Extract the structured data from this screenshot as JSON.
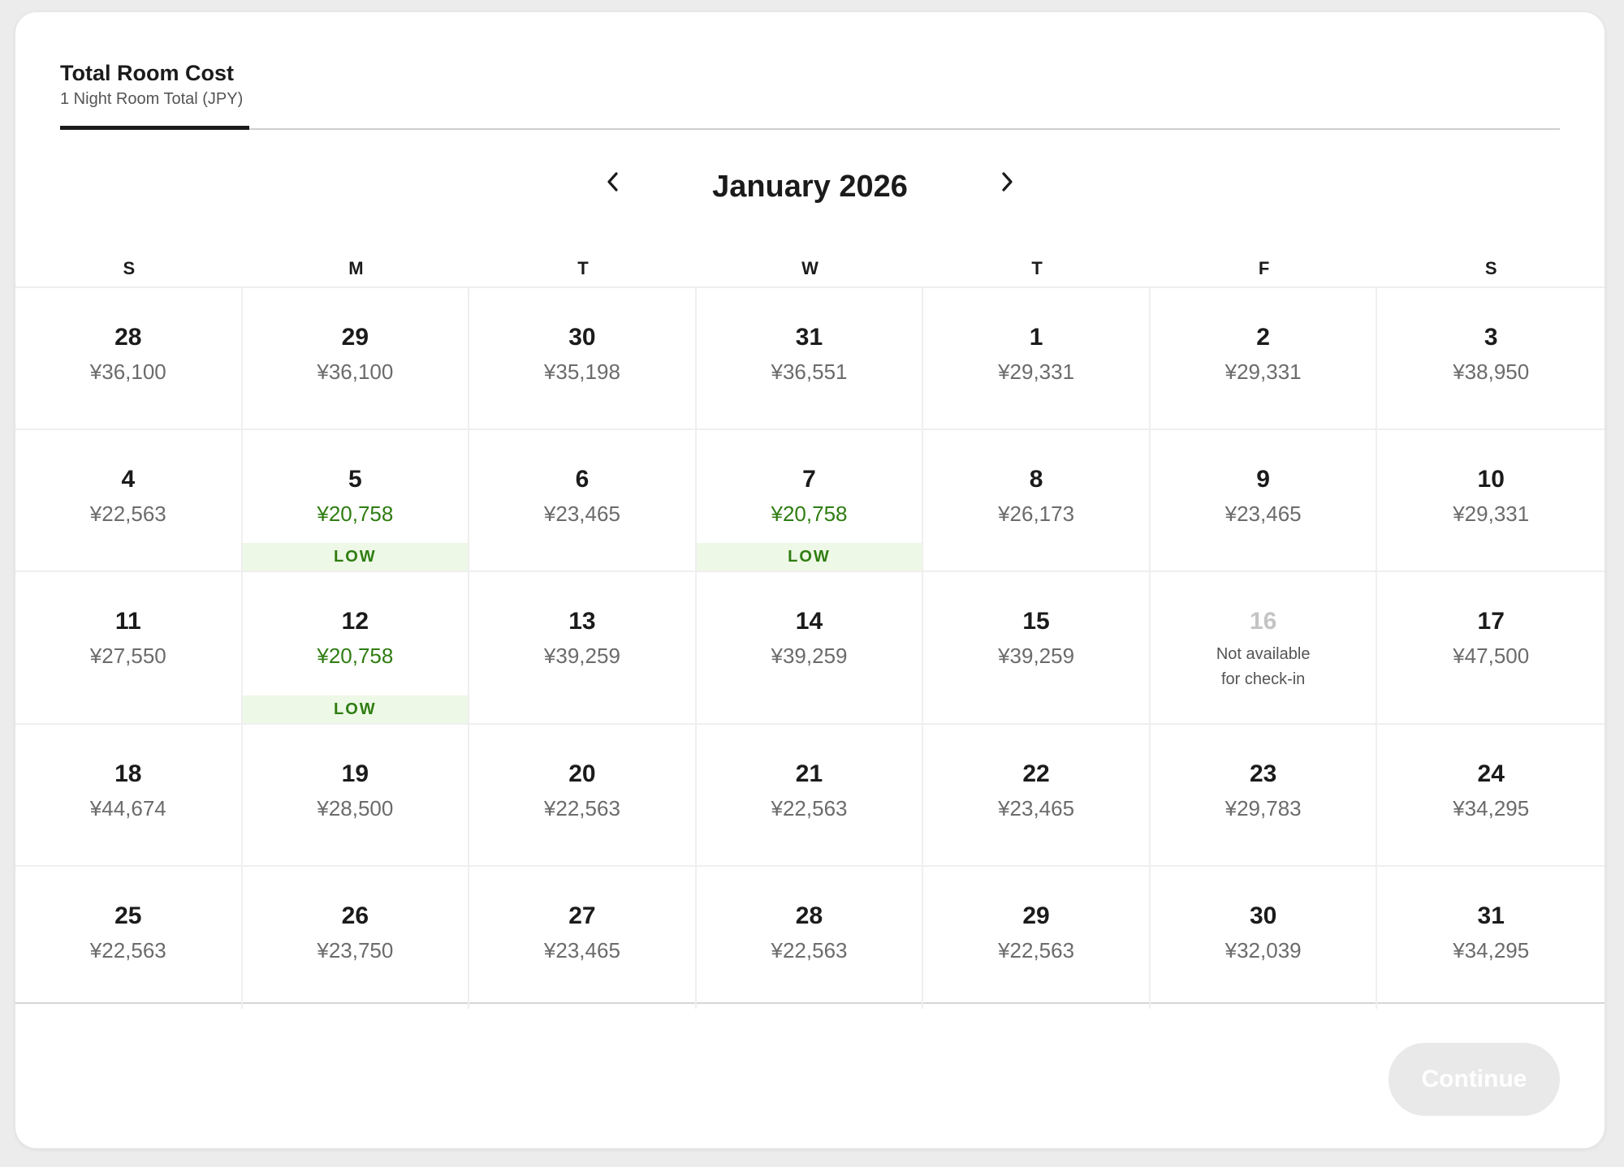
{
  "header": {
    "tab_title": "Total Room Cost",
    "tab_subtitle": "1 Night Room Total (JPY)"
  },
  "calendar": {
    "month_label": "January 2026",
    "prev_icon": "chevron-left-icon",
    "next_icon": "chevron-right-icon",
    "weekdays": [
      "S",
      "M",
      "T",
      "W",
      "T",
      "F",
      "S"
    ],
    "low_badge_label": "LOW",
    "unavailable_text_line1": "Not available",
    "unavailable_text_line2": "for check-in",
    "colors": {
      "low_price": "#2f7d12",
      "low_badge_bg": "#eef8e6",
      "regular_price": "#6b6b6b"
    },
    "days": [
      {
        "day": "28",
        "price": "¥36,100",
        "status": "normal"
      },
      {
        "day": "29",
        "price": "¥36,100",
        "status": "normal"
      },
      {
        "day": "30",
        "price": "¥35,198",
        "status": "normal"
      },
      {
        "day": "31",
        "price": "¥36,551",
        "status": "normal"
      },
      {
        "day": "1",
        "price": "¥29,331",
        "status": "normal"
      },
      {
        "day": "2",
        "price": "¥29,331",
        "status": "normal"
      },
      {
        "day": "3",
        "price": "¥38,950",
        "status": "normal"
      },
      {
        "day": "4",
        "price": "¥22,563",
        "status": "normal"
      },
      {
        "day": "5",
        "price": "¥20,758",
        "status": "low"
      },
      {
        "day": "6",
        "price": "¥23,465",
        "status": "normal"
      },
      {
        "day": "7",
        "price": "¥20,758",
        "status": "low"
      },
      {
        "day": "8",
        "price": "¥26,173",
        "status": "normal"
      },
      {
        "day": "9",
        "price": "¥23,465",
        "status": "normal"
      },
      {
        "day": "10",
        "price": "¥29,331",
        "status": "normal"
      },
      {
        "day": "11",
        "price": "¥27,550",
        "status": "normal"
      },
      {
        "day": "12",
        "price": "¥20,758",
        "status": "low"
      },
      {
        "day": "13",
        "price": "¥39,259",
        "status": "normal"
      },
      {
        "day": "14",
        "price": "¥39,259",
        "status": "normal"
      },
      {
        "day": "15",
        "price": "¥39,259",
        "status": "normal"
      },
      {
        "day": "16",
        "price": "",
        "status": "unavailable"
      },
      {
        "day": "17",
        "price": "¥47,500",
        "status": "normal"
      },
      {
        "day": "18",
        "price": "¥44,674",
        "status": "normal"
      },
      {
        "day": "19",
        "price": "¥28,500",
        "status": "normal"
      },
      {
        "day": "20",
        "price": "¥22,563",
        "status": "normal"
      },
      {
        "day": "21",
        "price": "¥22,563",
        "status": "normal"
      },
      {
        "day": "22",
        "price": "¥23,465",
        "status": "normal"
      },
      {
        "day": "23",
        "price": "¥29,783",
        "status": "normal"
      },
      {
        "day": "24",
        "price": "¥34,295",
        "status": "normal"
      },
      {
        "day": "25",
        "price": "¥22,563",
        "status": "normal"
      },
      {
        "day": "26",
        "price": "¥23,750",
        "status": "normal"
      },
      {
        "day": "27",
        "price": "¥23,465",
        "status": "normal"
      },
      {
        "day": "28",
        "price": "¥22,563",
        "status": "normal"
      },
      {
        "day": "29",
        "price": "¥22,563",
        "status": "normal"
      },
      {
        "day": "30",
        "price": "¥32,039",
        "status": "normal"
      },
      {
        "day": "31",
        "price": "¥34,295",
        "status": "normal"
      }
    ]
  },
  "footer": {
    "continue_label": "Continue",
    "continue_disabled": true
  }
}
